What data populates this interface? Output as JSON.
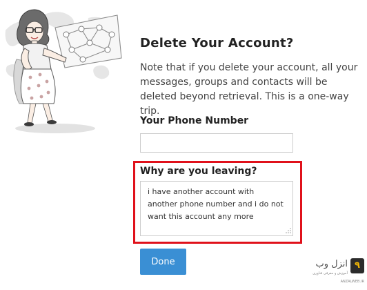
{
  "dialog": {
    "title": "Delete Your Account?",
    "note": "Note that if you delete your account, all your messages, groups and contacts will be deleted beyond retrieval. This is a one-way trip."
  },
  "phone": {
    "label": "Your Phone Number",
    "value": ""
  },
  "reason": {
    "label": "Why are you leaving?",
    "value": "i have another account with another phone number and i do not want this account any more"
  },
  "actions": {
    "done_label": "Done"
  },
  "watermark": {
    "title": "انزل وب",
    "subtitle": "آموزش و معرفی فناوری",
    "url": "ANZALWEB.IR"
  },
  "colors": {
    "accent": "#3a8fd4",
    "highlight": "#e0111b"
  },
  "icons": {
    "illustration": "woman-with-network-illustration",
    "resize": "resize-grip-icon"
  }
}
